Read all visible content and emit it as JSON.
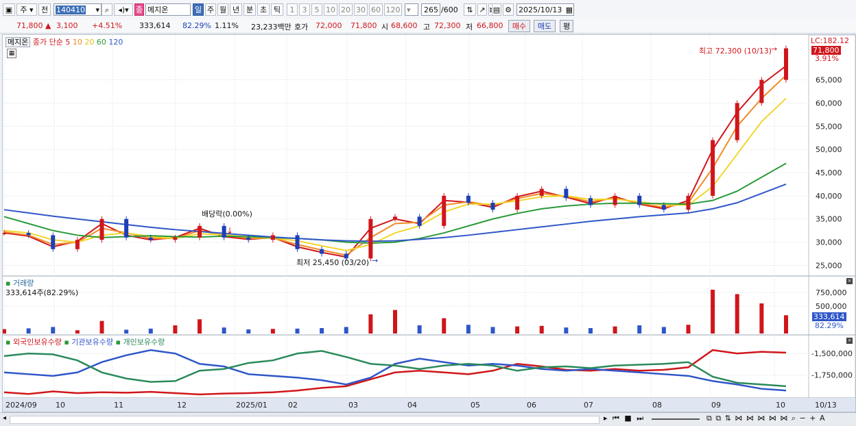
{
  "toolbar": {
    "type_label": "주",
    "prev_label": "전",
    "code": "140410",
    "stock_name": "메지온",
    "period_tabs": [
      "일",
      "주",
      "월",
      "년",
      "분",
      "초",
      "틱"
    ],
    "interval_tabs": [
      "1",
      "3",
      "5",
      "10",
      "20",
      "30",
      "60",
      "120"
    ],
    "count": "265",
    "count_total": "/600",
    "date": "2025/10/13"
  },
  "quote": {
    "price": "71,800",
    "change": "3,100",
    "change_pct": "+4.51%",
    "volume": "333,614",
    "vol_ratio": "82.29%",
    "turnover": "1.11%",
    "amount": "23,233백만",
    "ask_label": "호가",
    "ask": "72,000",
    "bid": "71,800",
    "open_label": "시",
    "open": "68,600",
    "high_label": "고",
    "high": "72,300",
    "low_label": "저",
    "low": "66,800",
    "buy_label": "매수",
    "sell_label": "매도",
    "eval_label": "평"
  },
  "legend": {
    "name": "메지온",
    "ma_label": "종가 단순",
    "ma_periods": [
      "5",
      "10",
      "20",
      "60",
      "120"
    ],
    "ma_colors": [
      "#d0161b",
      "#f08a24",
      "#f2d62b",
      "#2a9a3a",
      "#2f56c8"
    ]
  },
  "price_panel": {
    "lc_label": "LC:182.12",
    "current_price_tag": "71,800",
    "pct_tag": "3.91%",
    "max_annotation": "최고 72,300 (10/13)",
    "min_annotation": "최저 25,450 (03/20)",
    "dividend_annotation": "배당락(0.00%)"
  },
  "volume_panel": {
    "title": "거래량",
    "subtitle": "333,614주(82.29%)",
    "current_tag": "333,614",
    "pct_tag": "82.29%"
  },
  "holdings_panel": {
    "series_names": [
      "외국인보유수량",
      "기관보유수량",
      "개인보유수량"
    ],
    "series_colors": [
      "#d0161b",
      "#2f56c8",
      "#2a8a5a"
    ]
  },
  "date_labels": [
    "2024/09",
    "10",
    "11",
    "12",
    "2025/01",
    "02",
    "03",
    "04",
    "05",
    "06",
    "07",
    "08",
    "09",
    "10",
    "10/13"
  ],
  "chart_data": [
    {
      "type": "line",
      "title": "메지온",
      "price_axis_ticks": [
        25000,
        30000,
        35000,
        40000,
        45000,
        50000,
        55000,
        60000,
        65000
      ],
      "ylim": [
        23000,
        73500
      ],
      "x_months": [
        "2024/09",
        "10",
        "11",
        "12",
        "2025/01",
        "02",
        "03",
        "04",
        "05",
        "06",
        "07",
        "08",
        "09",
        "10"
      ],
      "series": [
        {
          "name": "종가",
          "values": [
            32000,
            31500,
            28500,
            30500,
            35000,
            31000,
            30500,
            31000,
            33500,
            31000,
            30500,
            31500,
            28500,
            27500,
            26500,
            35000,
            35500,
            33500,
            40000,
            38500,
            37000,
            40000,
            41500,
            39500,
            38000,
            40000,
            38000,
            37000,
            40000,
            52000,
            60000,
            65000,
            71800
          ]
        },
        {
          "name": "5",
          "values": [
            32000,
            31300,
            29000,
            30200,
            34000,
            31500,
            30500,
            31000,
            33000,
            31200,
            30600,
            31000,
            29000,
            27800,
            26800,
            33000,
            35000,
            34000,
            39000,
            38600,
            37500,
            39800,
            41000,
            39700,
            38300,
            39800,
            38200,
            37200,
            39000,
            50000,
            58000,
            64000,
            68000
          ]
        },
        {
          "name": "10",
          "values": [
            32200,
            31500,
            29500,
            30000,
            33000,
            32000,
            30800,
            30800,
            32500,
            31500,
            30800,
            30900,
            29500,
            28300,
            27200,
            31000,
            34000,
            34300,
            38000,
            38700,
            37900,
            39400,
            40500,
            39900,
            38700,
            39500,
            38400,
            37500,
            38500,
            46000,
            55000,
            61000,
            66000
          ]
        },
        {
          "name": "20",
          "values": [
            32500,
            32000,
            30500,
            30000,
            31500,
            32000,
            31200,
            30800,
            31800,
            31600,
            31100,
            30900,
            30300,
            29200,
            28200,
            29500,
            32000,
            33500,
            36500,
            38200,
            38200,
            38900,
            39800,
            40000,
            39200,
            39300,
            38700,
            38000,
            38000,
            42000,
            49000,
            56000,
            61000
          ]
        },
        {
          "name": "60",
          "values": [
            35500,
            34000,
            32500,
            31500,
            31000,
            31200,
            31400,
            31200,
            31100,
            31300,
            31200,
            31000,
            30800,
            30500,
            30000,
            29800,
            30000,
            30800,
            32000,
            33500,
            35000,
            36200,
            37200,
            37800,
            38200,
            38400,
            38400,
            38300,
            38200,
            39000,
            41000,
            44000,
            47000
          ]
        },
        {
          "name": "120",
          "values": [
            37000,
            36300,
            35600,
            35000,
            34400,
            33800,
            33200,
            32700,
            32300,
            31900,
            31500,
            31100,
            30800,
            30500,
            30300,
            30200,
            30300,
            30600,
            31000,
            31500,
            32100,
            32700,
            33300,
            33900,
            34500,
            35000,
            35500,
            35900,
            36300,
            37200,
            38500,
            40500,
            42500
          ]
        }
      ]
    },
    {
      "type": "bar",
      "title": "거래량",
      "volume_axis_ticks": [
        500000,
        750000
      ],
      "ylim": [
        0,
        1000000
      ],
      "values": [
        80000,
        95000,
        120000,
        60000,
        230000,
        70000,
        90000,
        150000,
        260000,
        110000,
        75000,
        85000,
        90000,
        100000,
        120000,
        350000,
        430000,
        150000,
        280000,
        160000,
        120000,
        130000,
        140000,
        110000,
        100000,
        130000,
        150000,
        120000,
        160000,
        800000,
        720000,
        550000,
        333614
      ]
    },
    {
      "type": "line",
      "title": "보유수량",
      "axis_ticks": [
        -1500000,
        -1750000
      ],
      "ylim": [
        -2000000,
        -1300000
      ],
      "series": [
        {
          "name": "외국인보유수량",
          "values": [
            -1950000,
            -1970000,
            -1940000,
            -1960000,
            -1950000,
            -1955000,
            -1945000,
            -1960000,
            -1975000,
            -1965000,
            -1960000,
            -1950000,
            -1930000,
            -1900000,
            -1880000,
            -1800000,
            -1720000,
            -1700000,
            -1720000,
            -1740000,
            -1700000,
            -1620000,
            -1650000,
            -1690000,
            -1700000,
            -1680000,
            -1700000,
            -1690000,
            -1660000,
            -1460000,
            -1500000,
            -1480000,
            -1490000
          ]
        },
        {
          "name": "기관보유수량",
          "values": [
            -1720000,
            -1740000,
            -1760000,
            -1720000,
            -1600000,
            -1520000,
            -1460000,
            -1500000,
            -1620000,
            -1650000,
            -1740000,
            -1760000,
            -1780000,
            -1810000,
            -1860000,
            -1780000,
            -1620000,
            -1560000,
            -1600000,
            -1640000,
            -1620000,
            -1640000,
            -1680000,
            -1700000,
            -1680000,
            -1700000,
            -1720000,
            -1740000,
            -1760000,
            -1820000,
            -1860000,
            -1910000,
            -1930000
          ]
        },
        {
          "name": "개인보유수량",
          "values": [
            -1530000,
            -1500000,
            -1510000,
            -1580000,
            -1720000,
            -1790000,
            -1830000,
            -1820000,
            -1700000,
            -1680000,
            -1610000,
            -1580000,
            -1500000,
            -1470000,
            -1540000,
            -1620000,
            -1640000,
            -1680000,
            -1640000,
            -1620000,
            -1640000,
            -1700000,
            -1660000,
            -1650000,
            -1670000,
            -1640000,
            -1630000,
            -1620000,
            -1600000,
            -1770000,
            -1840000,
            -1860000,
            -1880000
          ]
        }
      ]
    }
  ]
}
